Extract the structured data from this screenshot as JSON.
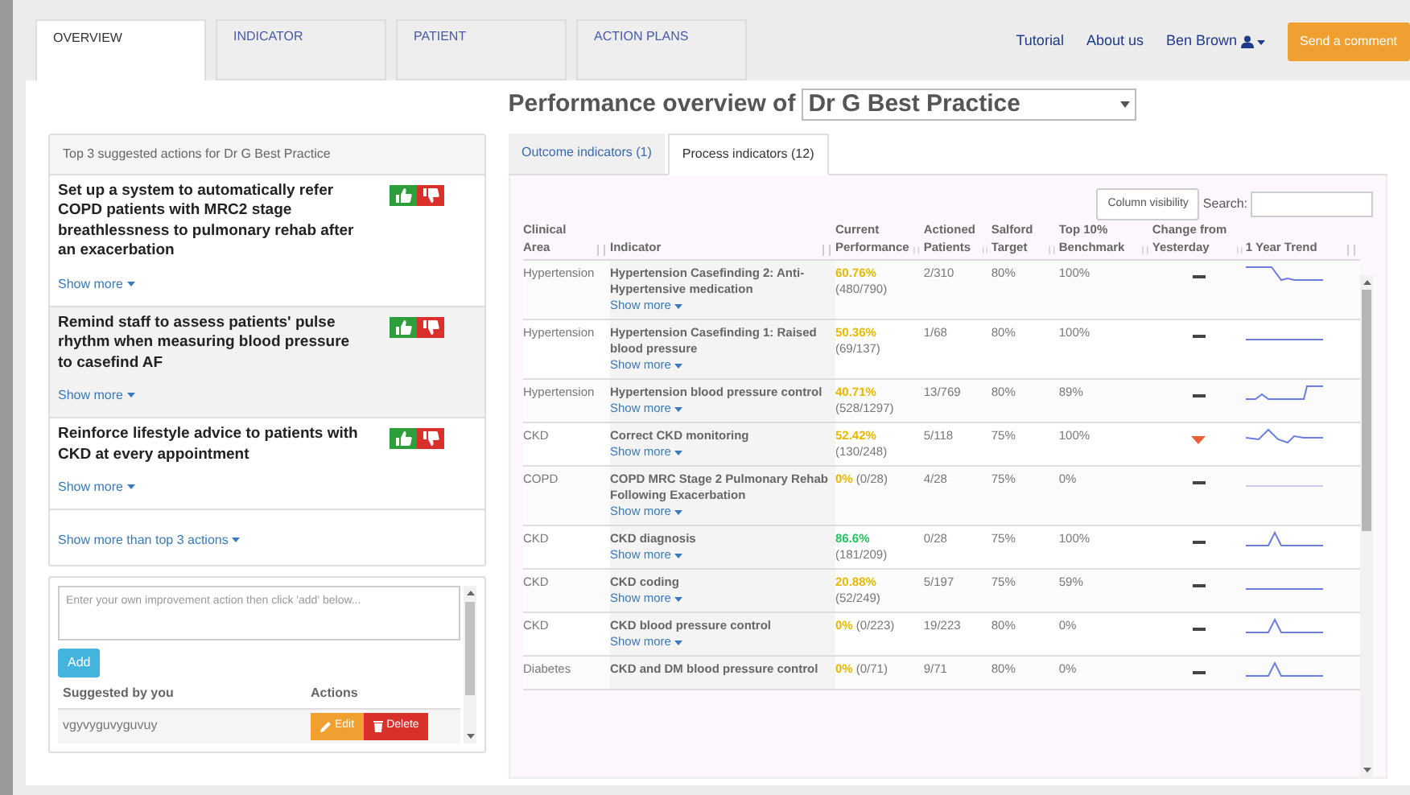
{
  "tabs": [
    {
      "label": "OVERVIEW",
      "selected": true
    },
    {
      "label": "INDICATOR",
      "selected": false
    },
    {
      "label": "PATIENT",
      "selected": false
    },
    {
      "label": "ACTION PLANS",
      "selected": false
    }
  ],
  "nav_links": [
    "Tutorial",
    "About us"
  ],
  "user": {
    "name": "Ben Brown"
  },
  "comment_button": "Send a comment",
  "title": {
    "prefix": "Performance overview of",
    "practice": "Dr G Best Practice"
  },
  "suggested_actions": {
    "heading": "Top 3 suggested actions for Dr G Best Practice",
    "items": [
      {
        "text": "Set up a system to automatically refer COPD patients with MRC2 stage breathlessness to pulmonary rehab after an exacerbation",
        "show_more": "Show more"
      },
      {
        "text": "Remind staff to assess patients' pulse rhythm when measuring blood pressure to casefind AF",
        "show_more": "Show more"
      },
      {
        "text": "Reinforce lifestyle advice to patients with CKD at every appointment",
        "show_more": "Show more"
      }
    ],
    "more_link": "Show more than top 3 actions"
  },
  "own_actions": {
    "placeholder": "Enter your own improvement action then click 'add' below...",
    "add_button": "Add",
    "columns": [
      "Suggested by you",
      "Actions"
    ],
    "rows": [
      {
        "text": "vgyvyguvyguvuy",
        "edit": "Edit",
        "delete": "Delete"
      }
    ]
  },
  "indicator_tabs": [
    {
      "label": "Outcome indicators (1)",
      "selected": false
    },
    {
      "label": "Process indicators (12)",
      "selected": true
    }
  ],
  "column_visibility": "Column visibility",
  "search_label": "Search:",
  "table": {
    "columns": [
      "Clinical Area",
      "Indicator",
      "Current Performance",
      "Actioned Patients",
      "Salford Target",
      "Top 10% Benchmark",
      "Change from Yesterday",
      "1 Year Trend"
    ],
    "rows": [
      {
        "area": "Hypertension",
        "indicator": "Hypertension Casefinding 2: Anti-Hypertensive medication",
        "show_more": "Show more",
        "percent": "60.76%",
        "fraction": "(480/790)",
        "color": "#e6b800",
        "actioned": "2/310",
        "target": "80%",
        "benchmark": "100%",
        "kind": "no_change"
      },
      {
        "area": "Hypertension",
        "indicator": "Hypertension Casefinding 1: Raised blood pressure",
        "show_more": "Show more",
        "percent": "50.36%",
        "fraction": "(69/137)",
        "color": "#e6b800",
        "actioned": "1/68",
        "target": "80%",
        "benchmark": "100%",
        "kind": "no_change"
      },
      {
        "area": "Hypertension",
        "indicator": "Hypertension blood pressure control",
        "show_more": "Show more",
        "percent": "40.71%",
        "fraction": "(528/1297)",
        "color": "#e6b800",
        "actioned": "13/769",
        "target": "80%",
        "benchmark": "89%",
        "kind": "no_change"
      },
      {
        "area": "CKD",
        "indicator": "Correct CKD monitoring",
        "show_more": "Show more",
        "percent": "52.42%",
        "fraction": "(130/248)",
        "color": "#e6b800",
        "actioned": "5/118",
        "target": "75%",
        "benchmark": "100%",
        "kind": "decrease"
      },
      {
        "area": "COPD",
        "indicator": "COPD MRC Stage 2 Pulmonary Rehab Following Exacerbation",
        "show_more": "Show more",
        "percent": "0%",
        "fraction": "(0/28)",
        "color": "#e6b800",
        "actioned": "4/28",
        "target": "75%",
        "benchmark": "0%",
        "kind": "no_change"
      },
      {
        "area": "CKD",
        "indicator": "CKD diagnosis",
        "show_more": "Show more",
        "percent": "86.6%",
        "fraction": "(181/209)",
        "color": "#22c55e",
        "actioned": "0/28",
        "target": "75%",
        "benchmark": "100%",
        "kind": "no_change"
      },
      {
        "area": "CKD",
        "indicator": "CKD coding",
        "show_more": "Show more",
        "percent": "20.88%",
        "fraction": "(52/249)",
        "color": "#e6b800",
        "actioned": "5/197",
        "target": "75%",
        "benchmark": "59%",
        "kind": "no_change"
      },
      {
        "area": "CKD",
        "indicator": "CKD blood pressure control",
        "show_more": "Show more",
        "percent": "0%",
        "fraction": "(0/223)",
        "color": "#e6b800",
        "actioned": "19/223",
        "target": "80%",
        "benchmark": "0%",
        "kind": "no_change"
      },
      {
        "area": "Diabetes",
        "indicator": "CKD and DM blood pressure control",
        "percent": "0%",
        "fraction": "(0/71)",
        "color": "#e6b800",
        "actioned": "9/71",
        "target": "80%",
        "benchmark": "0%",
        "kind": "no_change"
      }
    ]
  }
}
